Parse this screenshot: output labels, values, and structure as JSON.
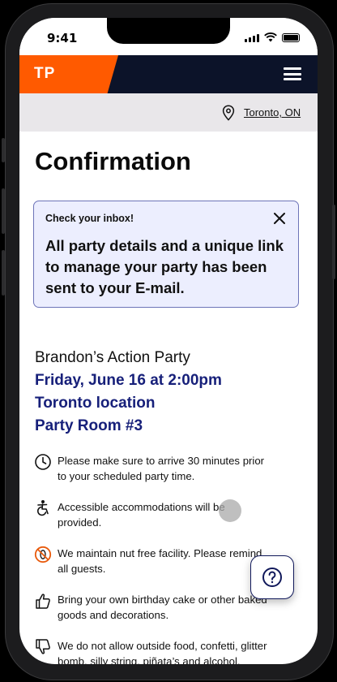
{
  "status_bar": {
    "time": "9:41"
  },
  "header": {
    "logo_text": "TP",
    "menu_icon": "hamburger-menu-icon"
  },
  "location": {
    "icon": "location-pin-icon",
    "text": "Toronto, ON"
  },
  "page": {
    "title": "Confirmation"
  },
  "alert": {
    "title": "Check your inbox!",
    "body": "All party details and a unique link to manage your party has been sent to your E-mail.",
    "close_icon": "close-icon"
  },
  "party": {
    "name": "Brandon’s Action Party",
    "datetime": "Friday, June 16 at 2:00pm",
    "location": "Toronto location",
    "room": "Party Room #3"
  },
  "info_items": [
    {
      "icon": "clock-icon",
      "text": "Please make sure to arrive 30 minutes prior to your scheduled party time."
    },
    {
      "icon": "accessibility-icon",
      "text": "Accessible accommodations will be provided."
    },
    {
      "icon": "nut-free-icon",
      "text": "We maintain nut free facility. Please remind all guests."
    },
    {
      "icon": "thumbs-up-icon",
      "text": "Bring your own birthday cake or other baked goods and decorations."
    },
    {
      "icon": "thumbs-down-icon",
      "text": "We do not allow outside food, confetti, glitter bomb, silly string, piñata’s and alcohol."
    }
  ],
  "help": {
    "icon": "help-question-icon"
  },
  "colors": {
    "brand_orange": "#ff5a00",
    "navy": "#0c1329",
    "accent_blue": "#17207a",
    "alert_bg": "#eceefe",
    "nut_icon": "#e85a0c"
  }
}
